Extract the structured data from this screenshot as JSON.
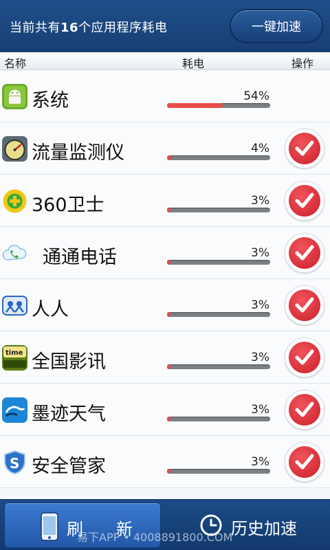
{
  "header": {
    "text_prefix": "当前共有",
    "count": "16",
    "text_suffix": "个应用程序耗电",
    "speed_button": "一键加速"
  },
  "columns": {
    "name": "名称",
    "power": "耗电",
    "action": "操作"
  },
  "apps": [
    {
      "name": "系统",
      "percent_label": "54%",
      "percent": 54,
      "icon": "android-icon",
      "has_action": false
    },
    {
      "name": "流量监测仪",
      "percent_label": "4%",
      "percent": 4,
      "icon": "speedometer-icon",
      "has_action": true
    },
    {
      "name": "360卫士",
      "percent_label": "3%",
      "percent": 3,
      "icon": "360-shield-icon",
      "has_action": true
    },
    {
      "name": "通通电话",
      "percent_label": "3%",
      "percent": 3,
      "icon": "cloud-phone-icon",
      "has_action": true
    },
    {
      "name": "人人",
      "percent_label": "3%",
      "percent": 3,
      "icon": "renren-icon",
      "has_action": true
    },
    {
      "name": "全国影讯",
      "percent_label": "3%",
      "percent": 3,
      "icon": "mtime-icon",
      "has_action": true
    },
    {
      "name": "墨迹天气",
      "percent_label": "3%",
      "percent": 3,
      "icon": "weather-icon",
      "has_action": true
    },
    {
      "name": "安全管家",
      "percent_label": "3%",
      "percent": 3,
      "icon": "security-s-icon",
      "has_action": true
    }
  ],
  "footer": {
    "refresh_label": "刷　　新",
    "history_label": "历史加速"
  },
  "watermark": "易下APP • 4008891800.COM",
  "colors": {
    "header_bg": "#1f4e8a",
    "bar_fill": "#e84a4a",
    "check_red": "#d8262f"
  }
}
